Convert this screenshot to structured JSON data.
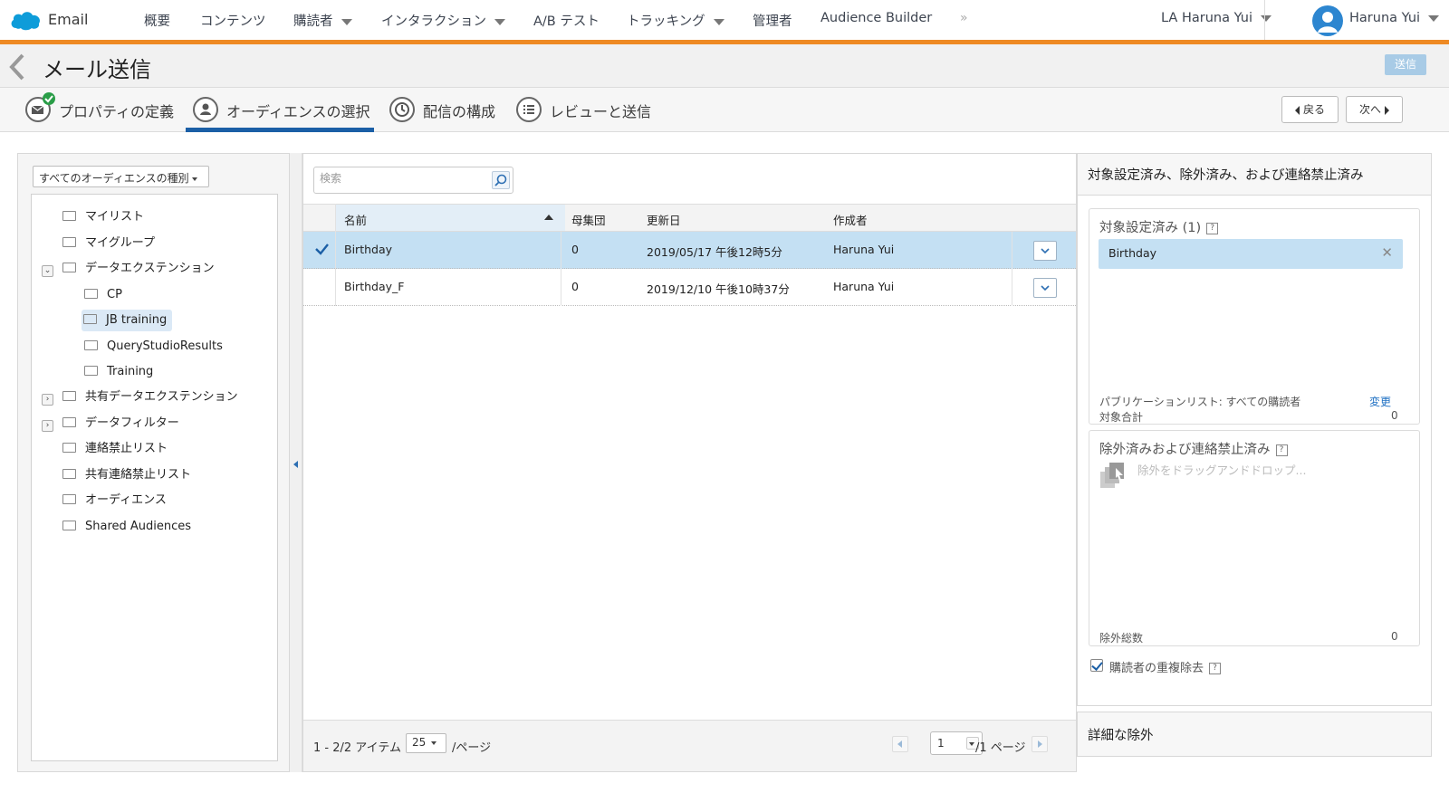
{
  "topnav": {
    "app_name": "Email",
    "items": [
      {
        "label": "概要",
        "dropdown": false
      },
      {
        "label": "コンテンツ",
        "dropdown": false
      },
      {
        "label": "購読者",
        "dropdown": true
      },
      {
        "label": "インタラクション",
        "dropdown": true
      },
      {
        "label": "A/B テスト",
        "dropdown": false
      },
      {
        "label": "トラッキング",
        "dropdown": true
      },
      {
        "label": "管理者",
        "dropdown": false
      },
      {
        "label": "Audience Builder",
        "dropdown": false
      }
    ],
    "more": "»",
    "account": "LA Haruna Yui",
    "user": "Haruna Yui",
    "accent_color": "#ee8a24"
  },
  "header": {
    "title": "メール送信",
    "send_label": "送信"
  },
  "steps": [
    {
      "label": "プロパティの定義",
      "icon": "envelope-check-icon",
      "active": false
    },
    {
      "label": "オーディエンスの選択",
      "icon": "audience-icon",
      "active": true
    },
    {
      "label": "配信の構成",
      "icon": "clock-icon",
      "active": false
    },
    {
      "label": "レビューと送信",
      "icon": "list-icon",
      "active": false
    }
  ],
  "nav_buttons": {
    "back": "戻る",
    "next": "次へ"
  },
  "left": {
    "type_select": "すべてのオーディエンスの種別",
    "tree": [
      {
        "label": "マイリスト"
      },
      {
        "label": "マイグループ"
      },
      {
        "label": "データエクステンション",
        "expanded": true
      },
      {
        "label": "CP"
      },
      {
        "label": "JB training",
        "selected": true
      },
      {
        "label": "QueryStudioResults"
      },
      {
        "label": "Training"
      },
      {
        "label": "共有データエクステンション",
        "expanded": false
      },
      {
        "label": "データフィルター",
        "expanded": false
      },
      {
        "label": "連絡禁止リスト"
      },
      {
        "label": "共有連絡禁止リスト"
      },
      {
        "label": "オーディエンス"
      },
      {
        "label": "Shared Audiences"
      }
    ]
  },
  "table": {
    "search_placeholder": "検索",
    "columns": [
      "名前",
      "母集団",
      "更新日",
      "作成者"
    ],
    "rows": [
      {
        "name": "Birthday",
        "population": "0",
        "updated": "2019/05/17 午後12時5分",
        "creator": "Haruna Yui",
        "selected": true
      },
      {
        "name": "Birthday_F",
        "population": "0",
        "updated": "2019/12/10 午後10時37分",
        "creator": "Haruna Yui",
        "selected": false
      }
    ],
    "footer": {
      "range": "1 - 2/2 アイテム",
      "per_page": "25",
      "per_page_suffix": "/ページ",
      "page": "1",
      "page_suffix": "/1 ページ"
    }
  },
  "right": {
    "title": "対象設定済み、除外済み、および連絡禁止済み",
    "targeted_title": "対象設定済み (1)",
    "targeted_items": [
      "Birthday"
    ],
    "publication_label": "パブリケーションリスト: すべての購読者",
    "change_label": "変更",
    "target_total_label": "対象合計",
    "target_total": "0",
    "excluded_title": "除外済みおよび連絡禁止済み",
    "drop_hint": "除外をドラッグアンドドロップ...",
    "excluded_total_label": "除外総数",
    "excluded_total": "0",
    "dedupe_label": "購読者の重複除去",
    "advanced_label": "詳細な除外"
  }
}
